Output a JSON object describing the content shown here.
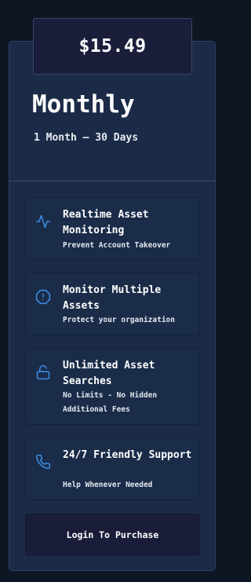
{
  "pricing": {
    "price": "$15.49",
    "plan_title": "Monthly",
    "plan_duration": "1 Month – 30 Days"
  },
  "features": [
    {
      "title": "Realtime Asset Monitoring",
      "subtitle": "Prevent Account Takeover",
      "icon": "activity-pulse-icon"
    },
    {
      "title": "Monitor Multiple Assets",
      "subtitle": "Protect your organization",
      "icon": "alert-octagon-icon"
    },
    {
      "title": "Unlimited Asset Searches",
      "subtitle": "No Limits - No Hidden Additional Fees",
      "icon": "unlock-icon"
    },
    {
      "title": "24/7 Friendly Support",
      "subtitle": "Help Whenever Needed",
      "icon": "phone-icon"
    }
  ],
  "actions": {
    "login_label": "Login To Purchase"
  },
  "colors": {
    "background": "#0e1624",
    "card": "#1b2b47",
    "price_box": "#1b1e3b",
    "accent_icon": "#3b8fe8",
    "button": "#1a1d3a"
  }
}
